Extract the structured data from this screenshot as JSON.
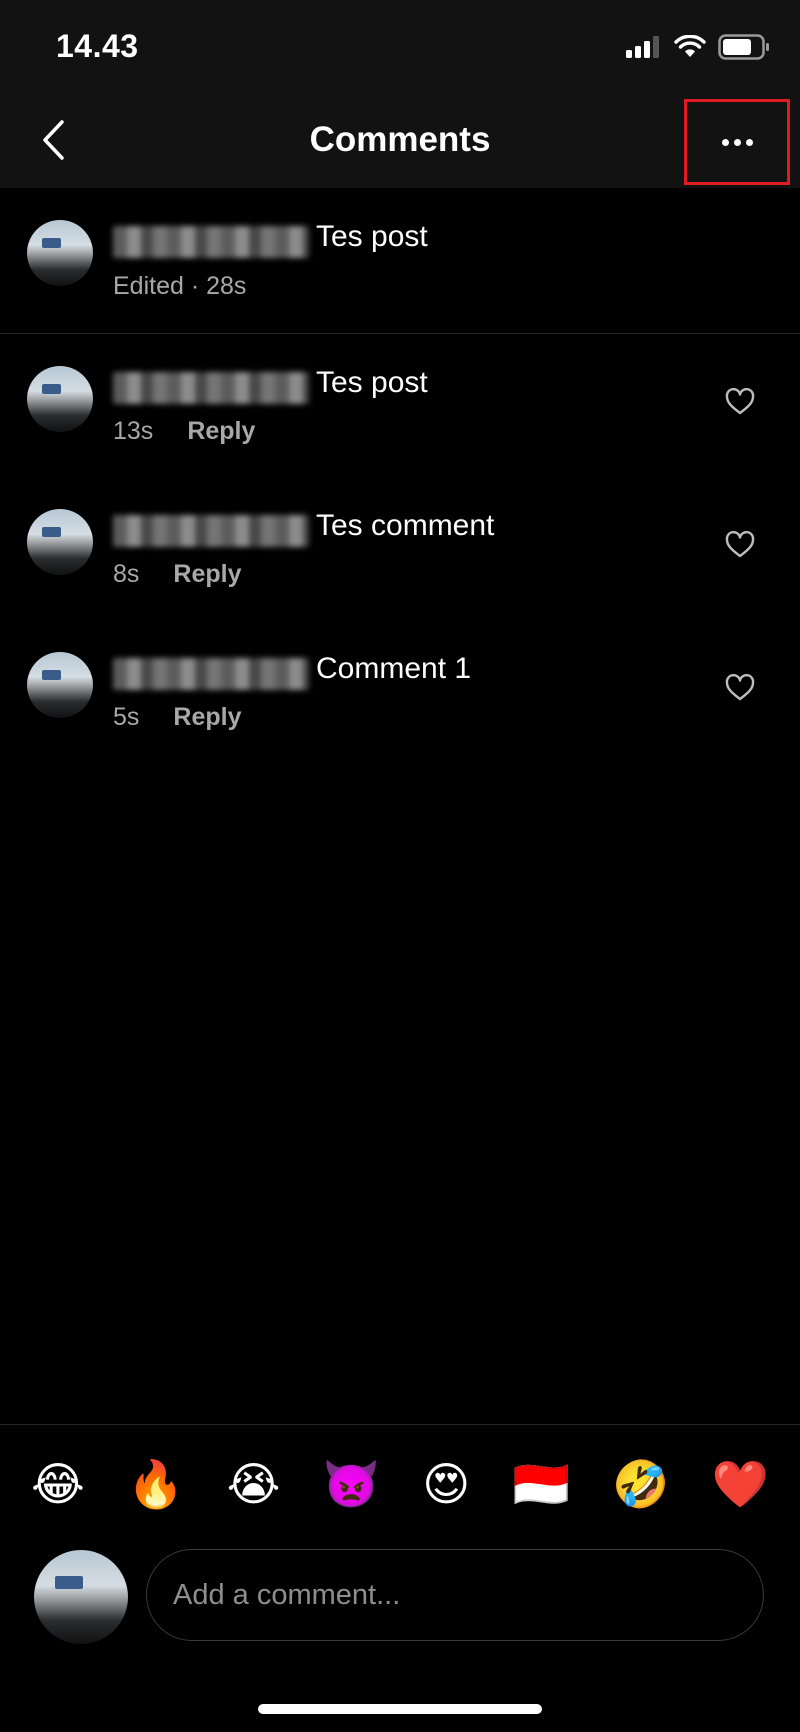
{
  "status": {
    "time": "14.43",
    "icons": [
      "signal-icon",
      "wifi-icon",
      "battery-icon"
    ]
  },
  "header": {
    "title": "Comments",
    "back_icon": "chevron-left-icon",
    "more_icon": "more-horizontal-icon",
    "highlight_color": "#e01b24"
  },
  "post": {
    "text": "Tes post",
    "meta": "Edited · 28s"
  },
  "comments": [
    {
      "text": "Tes post",
      "time": "13s",
      "reply_label": "Reply"
    },
    {
      "text": "Tes comment",
      "time": "8s",
      "reply_label": "Reply"
    },
    {
      "text": "Comment 1",
      "time": "5s",
      "reply_label": "Reply"
    }
  ],
  "emojis": [
    "😂",
    "🔥",
    "😭",
    "👿",
    "😍",
    "🇮🇩",
    "🤣",
    "❤️"
  ],
  "composer": {
    "placeholder": "Add a comment..."
  }
}
